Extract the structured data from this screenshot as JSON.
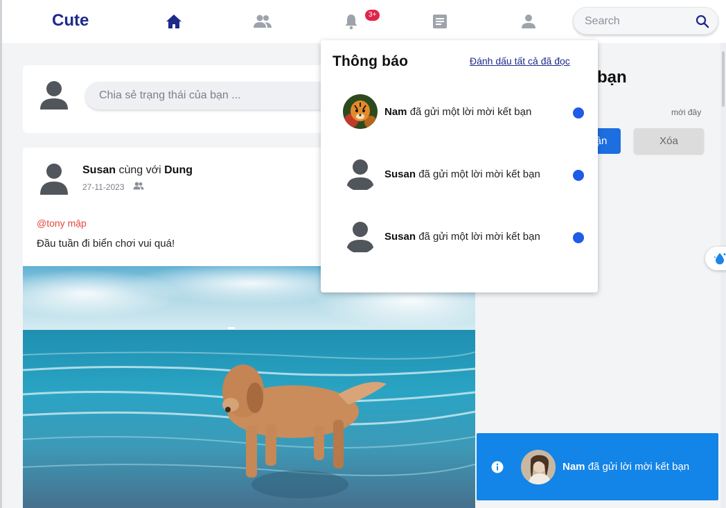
{
  "nav": {
    "brand": "Cute",
    "notification_badge": "3+",
    "search_placeholder": "Search"
  },
  "composer": {
    "placeholder": "Chia sẻ trạng thái của bạn ..."
  },
  "post": {
    "author": "Susan",
    "with_word": "cùng với",
    "with_user": "Dung",
    "date": "27-11-2023",
    "tag": "@tony mập",
    "caption": "Đầu tuần đi biển chơi vui quá!"
  },
  "friend_requests": {
    "title_partial": "bạn",
    "time": "mới đây",
    "accept_partial": "ận",
    "delete_label": "Xóa"
  },
  "notifications": {
    "title": "Thông báo",
    "mark_all_read": "Đánh dấu tất cả đã đọc",
    "items": [
      {
        "name": "Nam",
        "text": "đã gửi một lời mời kết bạn",
        "avatar": "tiger-avatar"
      },
      {
        "name": "Susan",
        "text": "đã gửi một lời mời kết bạn",
        "avatar": "default-avatar"
      },
      {
        "name": "Susan",
        "text": "đã gửi một lời mời kết bạn",
        "avatar": "default-avatar"
      }
    ]
  },
  "toast": {
    "name": "Nam",
    "text": "đã gửi lời mời kết bạn"
  },
  "colors": {
    "brand": "#1e2a8a",
    "badge": "#e0254a",
    "unread_dot": "#1f5ae8",
    "toast_bg": "#1384e8",
    "accept_bg": "#1d6fe0",
    "tag": "#e2453c"
  }
}
